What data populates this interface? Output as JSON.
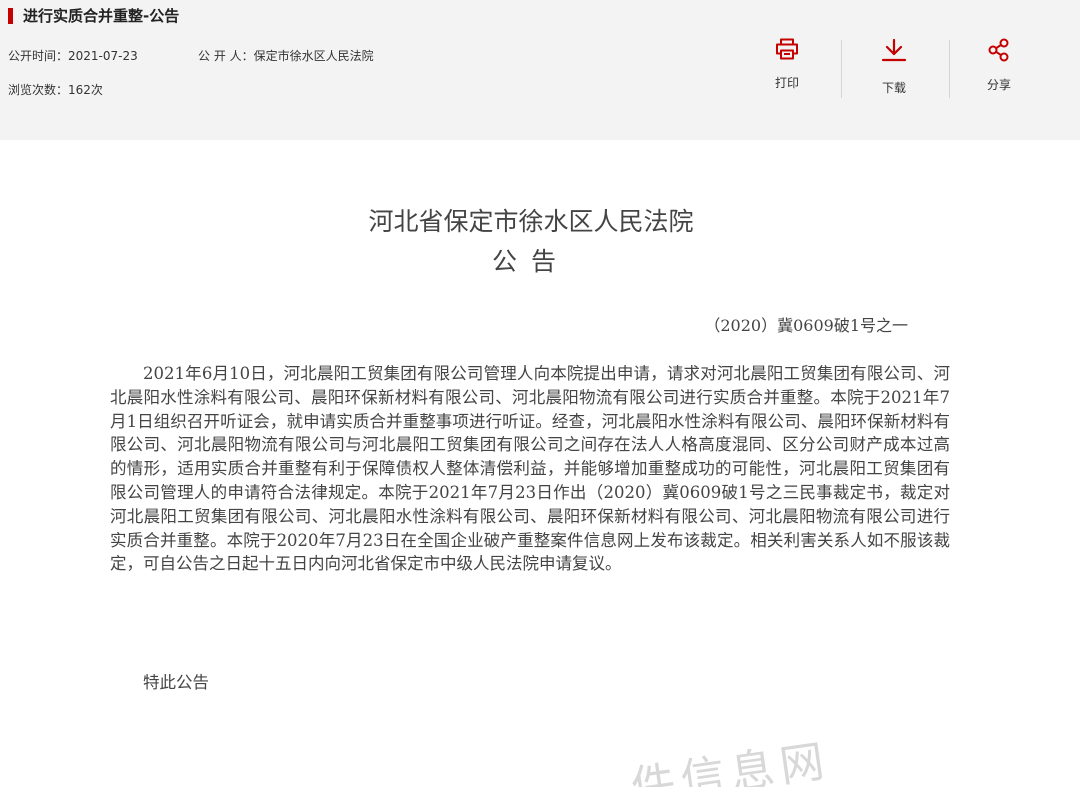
{
  "header": {
    "title": "进行实质合并重整-公告",
    "date_label": "公开时间：2021-07-23",
    "publisher_label": "公 开 人：保定市徐水区人民法院",
    "views_label": "浏览次数：162次"
  },
  "actions": {
    "print_label": "打印",
    "download_label": "下载",
    "share_label": "分享"
  },
  "document": {
    "court_name": "河北省保定市徐水区人民法院",
    "doc_type": "公告",
    "case_number": "（2020）冀0609破1号之一",
    "body": "2021年6月10日，河北晨阳工贸集团有限公司管理人向本院提出申请，请求对河北晨阳工贸集团有限公司、河北晨阳水性涂料有限公司、晨阳环保新材料有限公司、河北晨阳物流有限公司进行实质合并重整。本院于2021年7月1日组织召开听证会，就申请实质合并重整事项进行听证。经查，河北晨阳水性涂料有限公司、晨阳环保新材料有限公司、河北晨阳物流有限公司与河北晨阳工贸集团有限公司之间存在法人人格高度混同、区分公司财产成本过高的情形，适用实质合并重整有利于保障债权人整体清偿利益，并能够增加重整成功的可能性，河北晨阳工贸集团有限公司管理人的申请符合法律规定。本院于2021年7月23日作出（2020）冀0609破1号之三民事裁定书，裁定对河北晨阳工贸集团有限公司、河北晨阳水性涂料有限公司、晨阳环保新材料有限公司、河北晨阳物流有限公司进行实质合并重整。本院于2020年7月23日在全国企业破产重整案件信息网上发布该裁定。相关利害关系人如不服该裁定，可自公告之日起十五日内向河北省保定市中级人民法院申请复议。",
    "closing": "特此公告",
    "watermark": "件信息网"
  },
  "colors": {
    "accent": "#c40000",
    "header_bg": "#f3f3f3"
  },
  "icons": {
    "print": "printer-icon",
    "download": "download-icon",
    "share": "share-icon"
  }
}
